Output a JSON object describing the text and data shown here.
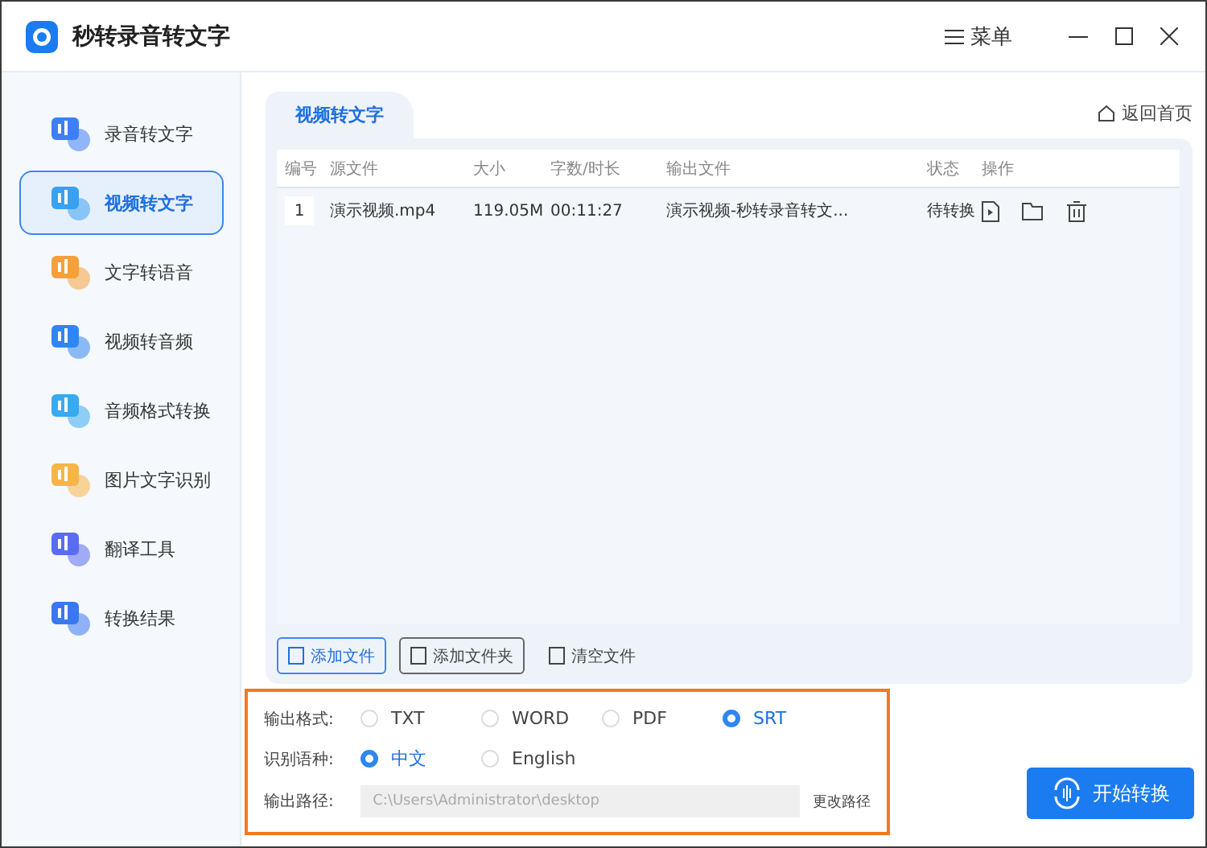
{
  "window": {
    "title": "秒转录音转文字",
    "menu": "菜单"
  },
  "sidebar": {
    "items": [
      {
        "label": "录音转文字",
        "selected": false,
        "color": "#3d7ff5"
      },
      {
        "label": "视频转文字",
        "selected": true,
        "color": "#3aa0f0"
      },
      {
        "label": "文字转语音",
        "selected": false,
        "color": "#f5a03c"
      },
      {
        "label": "视频转音频",
        "selected": false,
        "color": "#2f86f0"
      },
      {
        "label": "音频格式转换",
        "selected": false,
        "color": "#38aaf0"
      },
      {
        "label": "图片文字识别",
        "selected": false,
        "color": "#f7b548"
      },
      {
        "label": "翻译工具",
        "selected": false,
        "color": "#5a6cf0"
      },
      {
        "label": "转换结果",
        "selected": false,
        "color": "#3a78f0"
      }
    ]
  },
  "tab": {
    "label": "视频转文字",
    "selected": true
  },
  "home_link": "返回首页",
  "table": {
    "columns": [
      "编号",
      "源文件",
      "大小",
      "字数/时长",
      "输出文件",
      "状态",
      "操作"
    ],
    "rows": [
      {
        "index": "1",
        "source": "演示视频.mp4",
        "size": "119.05M",
        "duration": "00:11:27",
        "output": "演示视频-秒转录音转文...",
        "status": "待转换"
      }
    ]
  },
  "file_buttons": [
    "添加文件",
    "添加文件夹",
    "清空文件"
  ],
  "format": {
    "label": "输出格式:",
    "options": [
      {
        "label": "TXT",
        "selected": false
      },
      {
        "label": "WORD",
        "selected": false
      },
      {
        "label": "PDF",
        "selected": false
      },
      {
        "label": "SRT",
        "selected": true
      }
    ]
  },
  "language": {
    "label": "识别语种:",
    "options": [
      {
        "label": "中文",
        "selected": true
      },
      {
        "label": "English",
        "selected": false
      }
    ]
  },
  "output_path": {
    "label": "输出路径:",
    "value": "C:\\Users\\Administrator\\desktop",
    "change": "更改路径"
  },
  "start_button": "开始转换"
}
